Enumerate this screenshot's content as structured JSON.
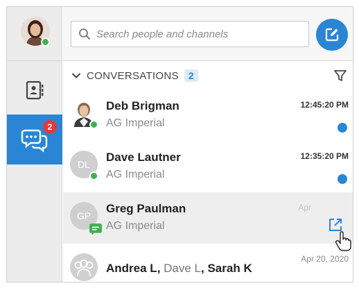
{
  "search": {
    "placeholder": "Search people and channels"
  },
  "nav": {
    "chat_badge": "2"
  },
  "section": {
    "title": "CONVERSATIONS",
    "count": "2"
  },
  "colors": {
    "accent": "#2a86d4",
    "presence": "#3fb153",
    "badge": "#e03a3a"
  },
  "conversations": [
    {
      "name": "Deb Brigman",
      "org": "AG Imperial",
      "time": "12:45:20 PM",
      "unread": true,
      "avatar": "photo"
    },
    {
      "name": "Dave Lautner",
      "org": "AG Imperial",
      "time": "12:35:20 PM",
      "unread": true,
      "avatar": "initials",
      "initials": "DL"
    },
    {
      "name": "Greg Paulman",
      "org": "AG Imperial",
      "time": "Apr",
      "avatar": "initials",
      "initials": "GP",
      "hovered": true
    },
    {
      "name_parts": [
        "Andrea L",
        "Dave L",
        "Sarah K"
      ],
      "name_separator": ", ",
      "time": "Apr 20, 2020",
      "avatar": "group"
    }
  ],
  "icons": {
    "user_avatar": "user-avatar-photo",
    "contacts": "contacts-icon",
    "chat": "chat-bubbles-icon",
    "search": "search-icon",
    "compose": "compose-icon",
    "chevron": "chevron-down-icon",
    "filter": "filter-icon",
    "popout": "popout-icon",
    "cursor": "hand-cursor-icon"
  }
}
